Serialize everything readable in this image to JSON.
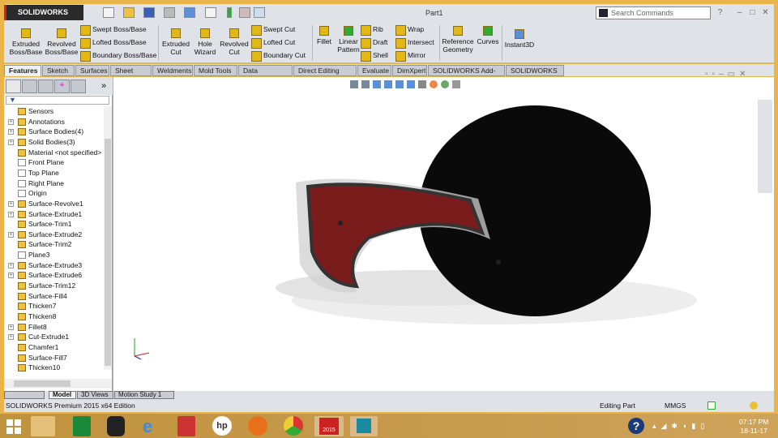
{
  "app": {
    "logo": "SOLIDWORKS",
    "title": "Part1",
    "search_placeholder": "Search Commands"
  },
  "ribbon": {
    "extruded_boss": "Extruded Boss/Base",
    "revolved_boss": "Revolved Boss/Base",
    "swept_boss": "Swept Boss/Base",
    "lofted_boss": "Lofted Boss/Base",
    "boundary_boss": "Boundary Boss/Base",
    "extruded_cut": "Extruded Cut",
    "hole_wizard": "Hole Wizard",
    "revolved_cut": "Revolved Cut",
    "swept_cut": "Swept Cut",
    "lofted_cut": "Lofted Cut",
    "boundary_cut": "Boundary Cut",
    "fillet": "Fillet",
    "linear_pattern": "Linear Pattern",
    "rib": "Rib",
    "draft": "Draft",
    "shell": "Shell",
    "wrap": "Wrap",
    "intersect": "Intersect",
    "mirror": "Mirror",
    "reference_geometry": "Reference Geometry",
    "curves": "Curves",
    "instant3d": "Instant3D"
  },
  "tabs": [
    "Features",
    "Sketch",
    "Surfaces",
    "Sheet Metal",
    "Weldments",
    "Mold Tools",
    "Data Migration",
    "Direct Editing",
    "Evaluate",
    "DimXpert",
    "SOLIDWORKS Add-Ins",
    "SOLIDWORKS MBD"
  ],
  "tree": [
    "Sensors",
    "Annotations",
    "Surface Bodies(4)",
    "Solid Bodies(3)",
    "Material <not specified>",
    "Front Plane",
    "Top Plane",
    "Right Plane",
    "Origin",
    "Surface-Revolve1",
    "Surface-Extrude1",
    "Surface-Trim1",
    "Surface-Extrude2",
    "Surface-Trim2",
    "Plane3",
    "Surface-Extrude3",
    "Surface-Extrude6",
    "Surface-Trim12",
    "Surface-Fill4",
    "Thicken7",
    "Thicken8",
    "Fillet8",
    "Cut-Extrude1",
    "Chamfer1",
    "Surface-Fill7",
    "Thicken10"
  ],
  "bottom_tabs": [
    "Model",
    "3D Views",
    "Motion Study 1"
  ],
  "status": {
    "edition": "SOLIDWORKS Premium 2015 x64 Edition",
    "mode": "Editing Part",
    "units": "MMGS"
  },
  "taskbar": {
    "time": "07:17 PM",
    "date": "18-11-17",
    "sw_badge": "2015"
  },
  "colors": {
    "helmet": "#0a0a0a",
    "visor_inner": "#7a1c1c",
    "frame": "#e9b54a"
  }
}
